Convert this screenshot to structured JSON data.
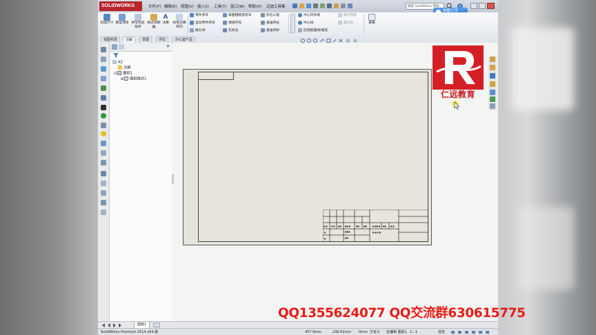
{
  "app": {
    "logo": "SOLIDWORKS",
    "menu": [
      "文件(F)",
      "编辑(E)",
      "视图(V)",
      "插入(I)",
      "工具(T)",
      "窗口(W)",
      "帮助(H)",
      "迈迪工具集"
    ],
    "search_placeholder": "搜索 SolidWorks 帮助",
    "upload_label": "拍摄上传"
  },
  "ribbon": {
    "big_buttons": [
      "智能尺寸",
      "模型项目",
      "拼写检验程序",
      "格式涂刷器",
      "注释",
      "线性注释阵列"
    ],
    "col1": [
      "零件序号",
      "自动零件序号",
      "磁力线"
    ],
    "col2": [
      "表面粗糙度符号",
      "焊接符号",
      "孔标注"
    ],
    "col3": [
      "形位公差",
      "基准特征",
      "基准目标"
    ],
    "col4": [
      "中心符号线",
      "中心线",
      "区域剖面线/填充"
    ],
    "col5": [
      "修订符号",
      "修订云"
    ],
    "table_label": "表格"
  },
  "tabs": [
    "视图布局",
    "注解",
    "草图",
    "评估",
    "办公室产品"
  ],
  "active_tab": "注解",
  "tree": {
    "root": "A3",
    "items": [
      "注解",
      "图纸1",
      "图纸格式1"
    ]
  },
  "sheet_tabs": [
    "图纸1"
  ],
  "status": {
    "product": "SolidWorks Premium 2014 x64 版",
    "x": "457.9mm",
    "y": "236.62mm",
    "z": "0mm",
    "state": "欠定义",
    "editing": "在编辑 图纸1",
    "scale": "2 : 1",
    "custom": "自定"
  },
  "watermark": {
    "brand": "仁远教育",
    "contact": "QQ1355624077  QQ交流群630615775"
  },
  "colors": {
    "accent_red": "#c9151e",
    "qq_red": "#e81c18",
    "sheet": "#e7e4db"
  }
}
